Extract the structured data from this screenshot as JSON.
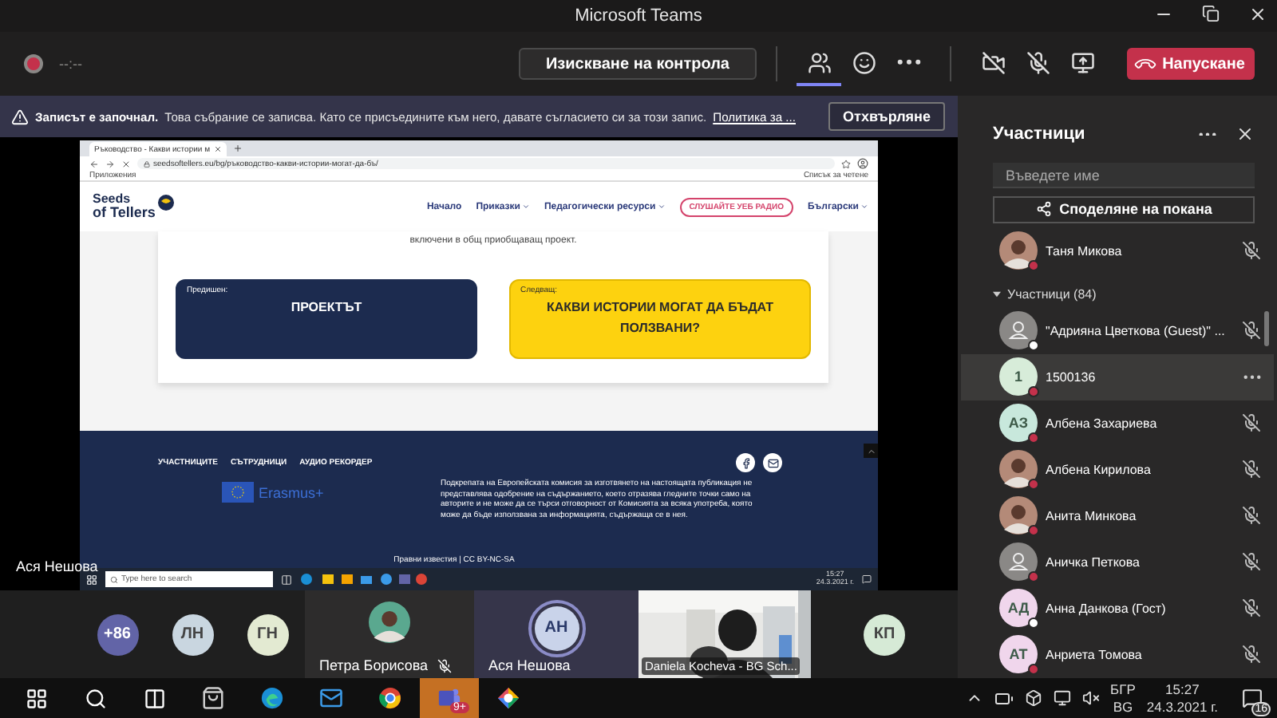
{
  "window": {
    "title": "Microsoft Teams"
  },
  "meeting_bar": {
    "timer": "--:--",
    "recording": true,
    "request_control": "Изискване на контрола",
    "panel_buttons": [
      {
        "kind": "people",
        "selected": true
      },
      {
        "kind": "reactions",
        "selected": false
      },
      {
        "kind": "more",
        "selected": false
      }
    ],
    "camera_on": false,
    "mic_on": false,
    "leave": "Напускане"
  },
  "banner": {
    "title": "Записът е започнал.",
    "message": "Това събрание се записва. Като се присъедините към него, давате съгласието си за този запис.",
    "link": "Политика за ...",
    "dismiss": "Отхвърляне"
  },
  "shared_screen": {
    "presenter": "Ася Нешова",
    "browser": {
      "tab": "Ръководство - Какви истории м",
      "url": "seedsoftellers.eu/bg/ръководство-какви-истории-могат-да-бъ/",
      "bookmark": "Приложения",
      "reading_list": "Списък за четене"
    },
    "site": {
      "logo_top": "Seeds",
      "logo_bottom": "of Tellers",
      "nav": [
        {
          "label": "Начало",
          "dropdown": false
        },
        {
          "label": "Приказки",
          "dropdown": true
        },
        {
          "label": "Педагогически ресурси",
          "dropdown": true
        }
      ],
      "radio": "СЛУШАЙТЕ УЕБ РАДИО",
      "language": "Български",
      "intro": "включени в общ приобщаващ проект.",
      "prev": {
        "label": "Предишен:",
        "title": "ПРОЕКТЪТ"
      },
      "next": {
        "label": "Следващ:",
        "title": "КАКВИ ИСТОРИИ МОГАТ ДА БЪДАТ ПОЛЗВАНИ?"
      },
      "footer_links": [
        "УЧАСТНИЦИТЕ",
        "СЪТРУДНИЦИ",
        "АУДИО РЕКОРДЕР"
      ],
      "erasmus": "Erasmus+",
      "disclaimer": "Подкрепата на Европейската комисия за изготвянето на настоящата публикация не представлява одобрение на съдържанието, което отразява гледните точки само на авторите и не може да се търси отговорност от Комисията за всяка употреба, която може да бъде използвана за информацията, съдържаща се в нея.",
      "legal": "Правни известия | CC BY-NC-SA"
    },
    "taskbar": {
      "search": "Type here to search",
      "time": "15:27",
      "date": "24.3.2021 г."
    }
  },
  "stage_tiles": [
    {
      "kind": "avatar",
      "initials": "+86",
      "color": "#6264a7"
    },
    {
      "kind": "avatar",
      "initials": "ЛН",
      "color": "#c9d6e0"
    },
    {
      "kind": "avatar",
      "initials": "ГН",
      "color": "#e3ead2"
    },
    {
      "kind": "person",
      "name": "Петра Борисова",
      "muted": true
    },
    {
      "kind": "speaker",
      "name": "Ася Нешова",
      "initials": "АН",
      "speaking": true
    },
    {
      "kind": "video",
      "name": "Daniela Kocheva - BG Sch..."
    },
    {
      "kind": "avatar",
      "initials": "КП",
      "color": "#d6ead6"
    }
  ],
  "participants": {
    "title": "Участници",
    "search_placeholder": "Въведете име",
    "share": "Споделяне на покана",
    "presenters": [
      {
        "name": "Таня Микова",
        "color": "#c4314b",
        "muted": true,
        "selected": false
      }
    ],
    "group": {
      "label": "Участници (84)",
      "expanded": true
    },
    "people": [
      {
        "name": "\"Адрияна Цветкова (Guest)\" ...",
        "avatar": {
          "kind": "guest"
        },
        "color": "#ffffff",
        "muted": true,
        "selected": false
      },
      {
        "name": "1500136",
        "avatar": {
          "kind": "initials",
          "initials": "1",
          "color": "#d7ecd9"
        },
        "color": "#c4314b",
        "selected": true
      },
      {
        "name": "Албена Захариева",
        "avatar": {
          "kind": "initials",
          "initials": "АЗ",
          "color": "#c8e8dc"
        },
        "color": "#c4314b",
        "muted": true,
        "selected": false
      },
      {
        "name": "Албена Кирилова",
        "color": "#c4314b",
        "muted": true,
        "selected": false
      },
      {
        "name": "Анита Минкова",
        "color": "#c4314b",
        "muted": true,
        "selected": false
      },
      {
        "name": "Аничка Петкова",
        "avatar": {
          "kind": "guest"
        },
        "color": "#c4314b",
        "muted": true,
        "selected": false
      },
      {
        "name": "Анна Данкова (Гост)",
        "avatar": {
          "kind": "initials",
          "initials": "АД",
          "color": "#f0d6ec"
        },
        "color": "#ffffff",
        "muted": true,
        "selected": false
      },
      {
        "name": "Анриета Томова",
        "avatar": {
          "kind": "initials",
          "initials": "АТ",
          "color": "#f0d6ec"
        },
        "color": "#c4314b",
        "muted": true,
        "selected": false
      }
    ]
  },
  "taskbar": {
    "apps": [
      {
        "kind": "store",
        "flashing": false
      },
      {
        "kind": "edge",
        "flashing": false
      },
      {
        "kind": "mail",
        "flashing": false
      },
      {
        "kind": "chrome",
        "flashing": false
      },
      {
        "kind": "teams",
        "flashing": true,
        "badge": "9+"
      },
      {
        "kind": "photos",
        "flashing": false
      }
    ],
    "language_top": "БГР",
    "language_bottom": "BG",
    "time": "15:27",
    "date": "24.3.2021 г.",
    "notifications": "16"
  }
}
